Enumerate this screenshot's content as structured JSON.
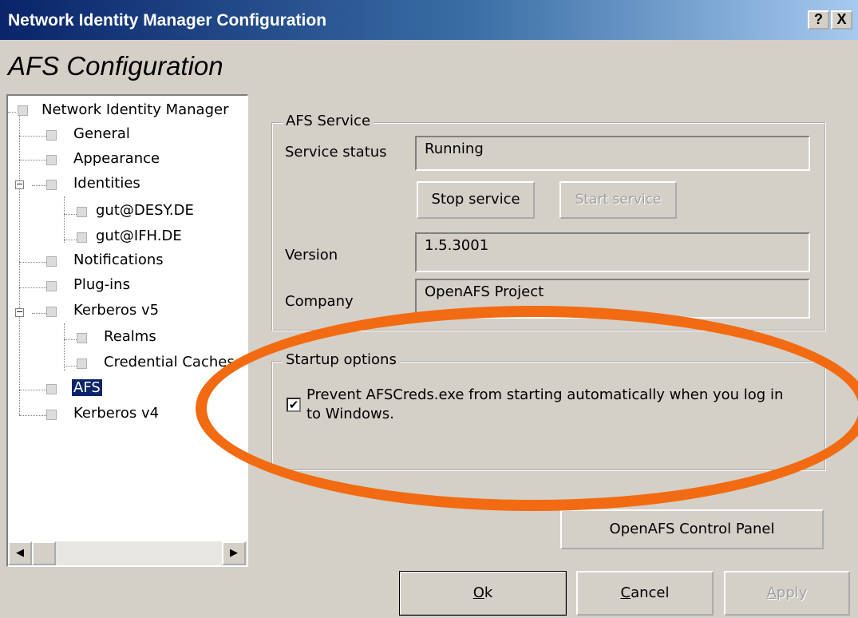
{
  "window": {
    "title": "Network Identity Manager Configuration",
    "help_button": "?",
    "close_button": "X"
  },
  "page": {
    "heading": "AFS Configuration"
  },
  "tree": {
    "root": "Network Identity Manager",
    "items": [
      "General",
      "Appearance",
      "Identities",
      "gut@DESY.DE",
      "gut@IFH.DE",
      "Notifications",
      "Plug-ins",
      "Kerberos v5",
      "Realms",
      "Credential Caches",
      "AFS",
      "Kerberos v4"
    ],
    "selected": "AFS"
  },
  "afs_service": {
    "legend": "AFS Service",
    "status_label": "Service status",
    "status_value": "Running",
    "stop_button": "Stop service",
    "start_button": "Start service",
    "version_label": "Version",
    "version_value": "1.5.3001",
    "company_label": "Company",
    "company_value": "OpenAFS Project"
  },
  "startup": {
    "legend": "Startup options",
    "checkbox_checked": true,
    "checkbox_label_line1": "Prevent AFSCreds.exe from starting automatically when you log in",
    "checkbox_label_line2": "to Windows."
  },
  "control_panel_button": "OpenAFS Control Panel",
  "footer": {
    "ok": {
      "accel": "O",
      "rest": "k"
    },
    "cancel": {
      "accel": "C",
      "rest": "ancel"
    },
    "apply": {
      "accel": "A",
      "rest": "pply"
    }
  },
  "colors": {
    "titlebar": "#0a246a",
    "dialog_bg": "#d4d0c8",
    "highlight_ellipse": "#f26b12",
    "selection": "#0a246a"
  }
}
